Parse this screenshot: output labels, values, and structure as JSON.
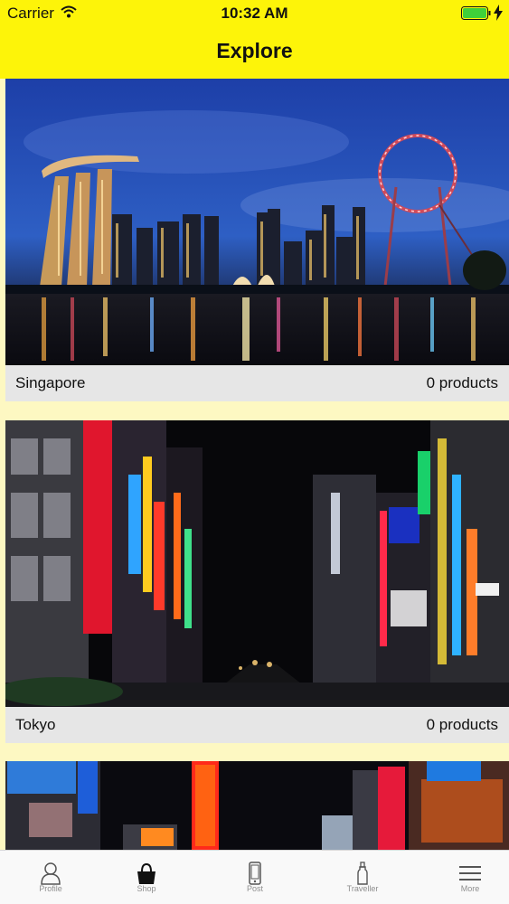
{
  "status_bar": {
    "carrier": "Carrier",
    "time": "10:32 AM",
    "battery_color": "#3fd13a"
  },
  "header": {
    "title": "Explore",
    "background": "#fdf409"
  },
  "cards": [
    {
      "city": "Singapore",
      "count": "0 products"
    },
    {
      "city": "Tokyo",
      "count": "0 products"
    },
    {
      "city": "",
      "count": ""
    }
  ],
  "tabbar": {
    "items": [
      {
        "label": "Profile",
        "icon": "person-icon"
      },
      {
        "label": "Shop",
        "icon": "shopping-bag-icon"
      },
      {
        "label": "Post",
        "icon": "phone-icon"
      },
      {
        "label": "Traveller",
        "icon": "bottle-icon"
      },
      {
        "label": "More",
        "icon": "menu-icon"
      }
    ]
  }
}
